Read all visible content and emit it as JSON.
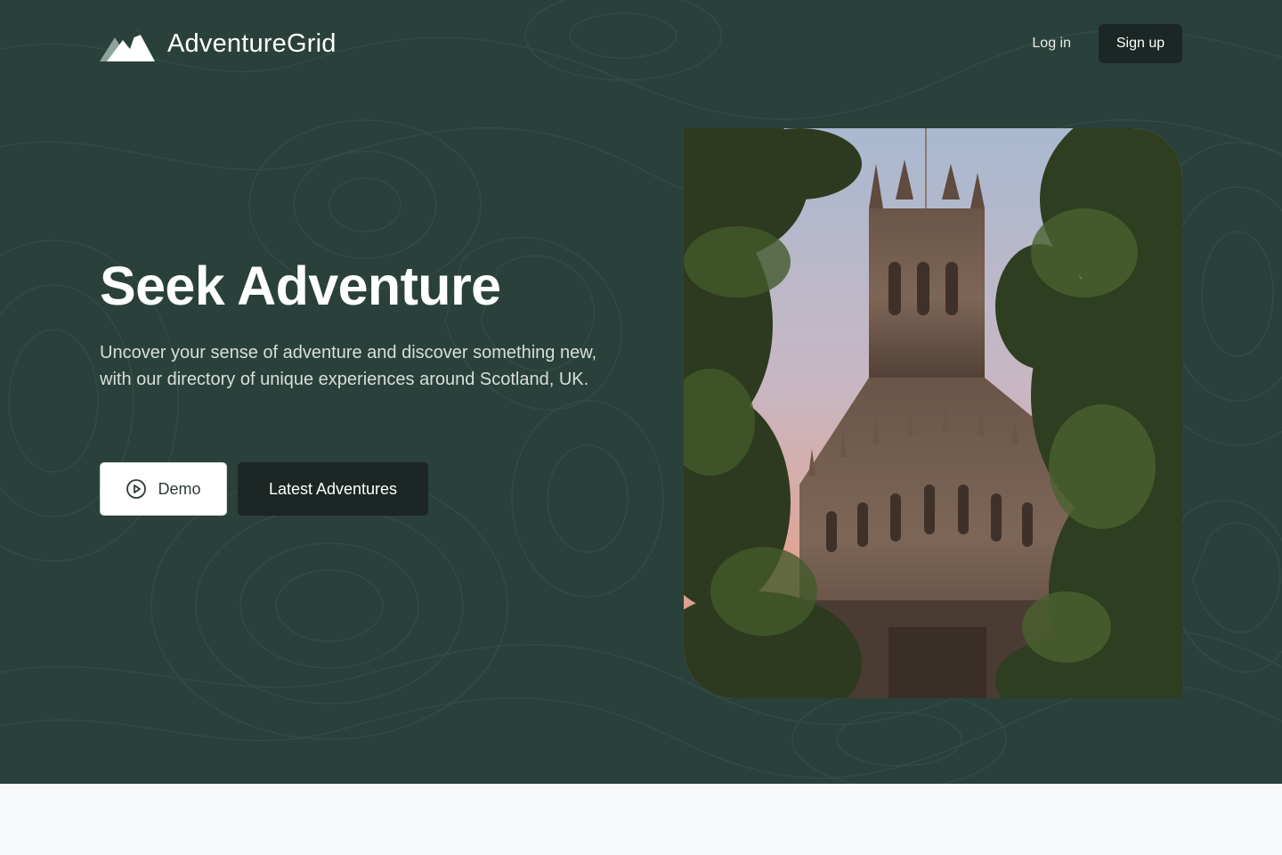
{
  "brand": {
    "name": "AdventureGrid",
    "logo_icon": "mountain-peaks-icon"
  },
  "nav": {
    "login_label": "Log in",
    "signup_label": "Sign up"
  },
  "hero": {
    "headline": "Seek Adventure",
    "subtitle": "Uncover your sense of adventure and discover something new, with our directory of unique experiences around Scotland, UK.",
    "demo_label": "Demo",
    "demo_icon": "play-circle-icon",
    "latest_label": "Latest Adventures",
    "image_subject": "gothic-cathedral-photo"
  },
  "colors": {
    "hero_bg": "#2a413b",
    "dark_button": "#1c2624",
    "light_button": "#ffffff",
    "page_bg": "#f8f9fb",
    "text_light": "#d7dfdb"
  }
}
